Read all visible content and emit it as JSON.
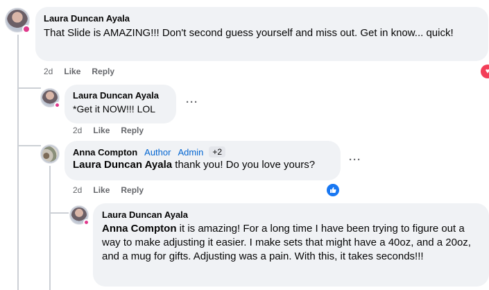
{
  "comments": [
    {
      "author": "Laura Duncan Ayala",
      "text": "That Slide is AMAZING!!! Don't second guess yourself and miss out. Get in know... quick!",
      "time": "2d",
      "like": "Like",
      "reply": "Reply",
      "reaction_icon": "heart-icon"
    },
    {
      "author": "Laura Duncan Ayala",
      "text": "*Get it NOW!!! LOL",
      "time": "2d",
      "like": "Like",
      "reply": "Reply",
      "menu": "···"
    },
    {
      "author": "Anna Compton",
      "roles": [
        "Author",
        "Admin"
      ],
      "extra_badges": "+2",
      "mention": "Laura Duncan Ayala",
      "text": " thank you! Do you love yours?",
      "time": "2d",
      "like": "Like",
      "reply": "Reply",
      "menu": "···",
      "reaction_icon": "like-icon"
    },
    {
      "author": "Laura Duncan Ayala",
      "mention": "Anna Compton",
      "text": " it is amazing! For a long time I have been trying to figure out a way to make adjusting it easier. I make sets that might have a 40oz, and a 20oz, and a mug for gifts. Adjusting was a pain. With this, it takes seconds!!!"
    }
  ],
  "colors": {
    "bubble": "#f0f2f5",
    "meta": "#65676b",
    "role": "#0064d1",
    "like": "#1877f2",
    "heart": "#f33e58"
  }
}
